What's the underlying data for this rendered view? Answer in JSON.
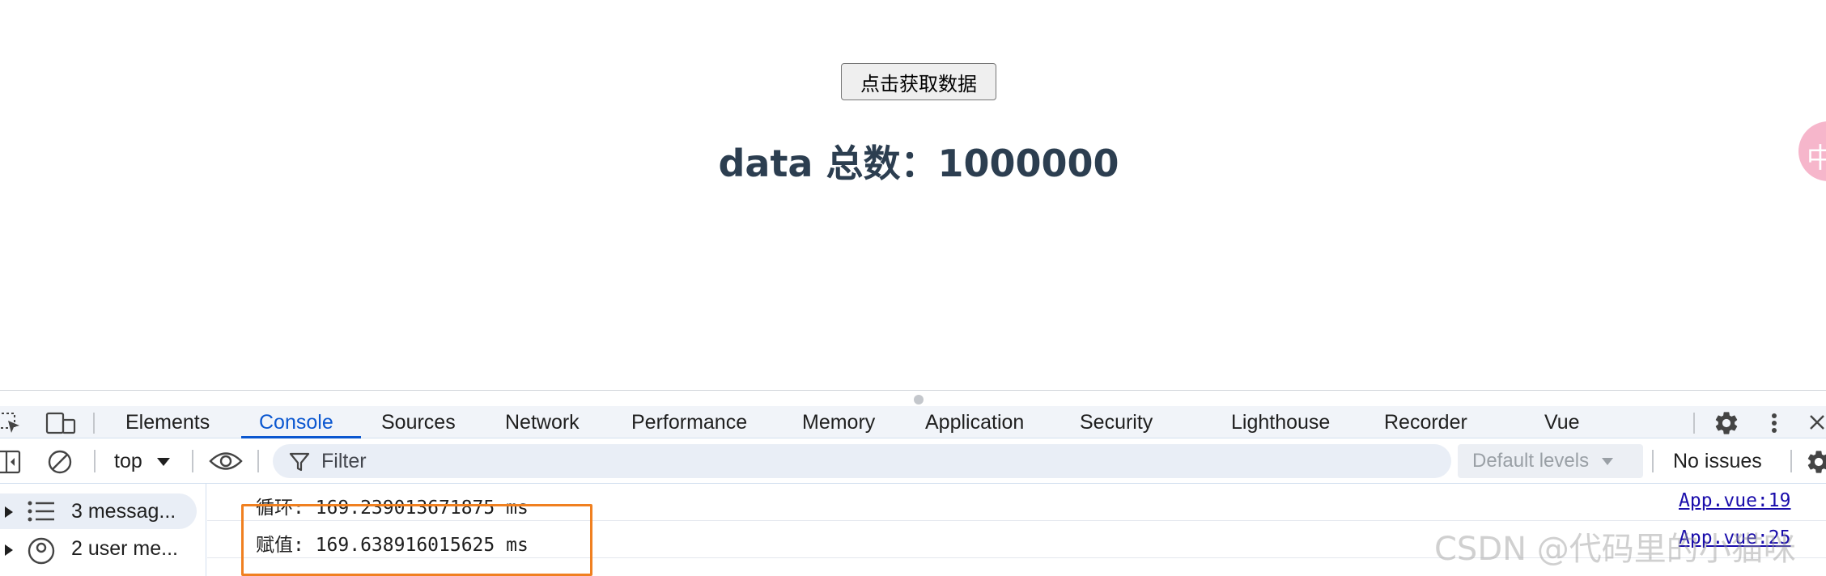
{
  "page": {
    "fetch_button_label": "点击获取数据",
    "data_count_text": "data 总数：1000000",
    "float_bubble_text": "中"
  },
  "devtools": {
    "tabs": [
      "Elements",
      "Console",
      "Sources",
      "Network",
      "Performance",
      "Memory",
      "Application",
      "Security",
      "Lighthouse",
      "Recorder",
      "Vue"
    ],
    "active_tab": "Console",
    "toolbar": {
      "context": "top",
      "filter_placeholder": "Filter",
      "levels": "Default levels",
      "issues": "No issues"
    },
    "sidebar": [
      {
        "label": "3 messag...",
        "selected": true
      },
      {
        "label": "2 user me...",
        "selected": false
      }
    ],
    "logs": [
      {
        "text": "循环: 169.239013671875 ms",
        "source": "App.vue:19"
      },
      {
        "text": "赋值: 169.638916015625 ms",
        "source": "App.vue:25"
      }
    ]
  },
  "watermark": "CSDN @代码里的小猫咪",
  "colors": {
    "accent": "#0b57d0",
    "heading": "#2c3e50",
    "highlight": "#f08020",
    "link": "#1a0dab"
  },
  "icons": [
    "inspect-element-icon",
    "device-toolbar-icon",
    "settings-gear-icon",
    "more-vertical-icon",
    "close-icon",
    "sidebar-toggle-icon",
    "clear-console-icon",
    "dropdown-arrow-icon",
    "eye-icon",
    "filter-funnel-icon",
    "list-icon",
    "user-circle-icon"
  ]
}
